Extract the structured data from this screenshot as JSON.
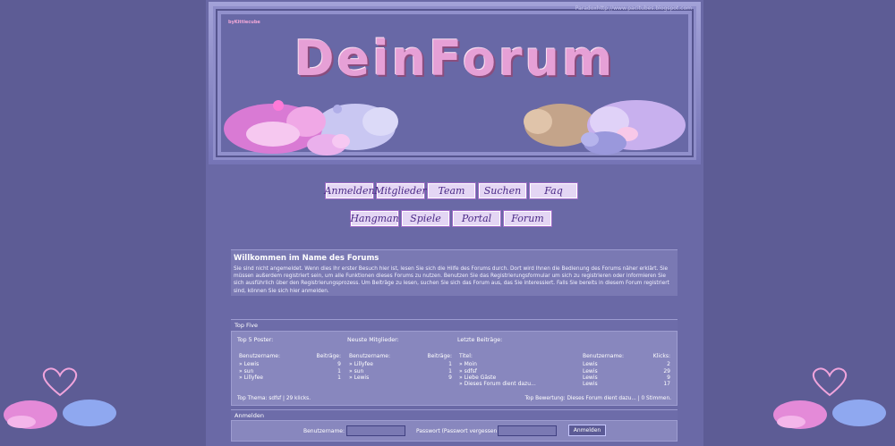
{
  "banner": {
    "tag": "byKittiecube",
    "credit": "Paradoxhttp://www.pacitubes.blogspot.com",
    "title": "DeinForum"
  },
  "nav": {
    "row1": [
      "Anmelden",
      "Mitglieder",
      "Team",
      "Suchen",
      "Faq"
    ],
    "row2": [
      "Hangman",
      "Spiele",
      "Portal",
      "Forum"
    ]
  },
  "welcome": {
    "title": "Willkommen im Name des Forums",
    "text": "Sie sind nicht angemeldet. Wenn dies Ihr erster Besuch hier ist, lesen Sie sich die Hilfe des Forums durch. Dort wird Ihnen die Bedienung des Forums näher erklärt. Sie müssen außerdem registriert sein, um alle Funktionen dieses Forums zu nutzen. Benutzen Sie das Registrierungsformular um sich zu registrieren oder informieren Sie sich ausführlich über den Registrierungsprozess. Um Beiträge zu lesen, suchen Sie sich das Forum aus, das Sie interessiert. Falls Sie bereits in diesem Forum registriert sind, können Sie sich hier anmelden."
  },
  "topfive": {
    "header": "Top Five",
    "posters": {
      "title": "Top 5 Poster:",
      "col_user": "Benutzername:",
      "col_count": "Beiträge:",
      "rows": [
        {
          "name": "» Lewis",
          "count": "9"
        },
        {
          "name": "» sun",
          "count": "1"
        },
        {
          "name": "» Lillyfee",
          "count": "1"
        }
      ]
    },
    "members": {
      "title": "Neuste Mitglieder:",
      "col_user": "Benutzername:",
      "col_count": "Beiträge:",
      "rows": [
        {
          "name": "» Lillyfee",
          "count": "1"
        },
        {
          "name": "» sun",
          "count": "1"
        },
        {
          "name": "» Lewis",
          "count": "9"
        }
      ]
    },
    "posts": {
      "title": "Letzte Beiträge:",
      "col_title": "Titel:",
      "col_user": "Benutzername:",
      "col_clicks": "Klicks:",
      "rows": [
        {
          "title": "» Moin",
          "user": "Lewis",
          "clicks": "2"
        },
        {
          "title": "» sdfsf",
          "user": "Lewis",
          "clicks": "29"
        },
        {
          "title": "» Liebe Gäste",
          "user": "Lewis",
          "clicks": "9"
        },
        {
          "title": "» Dieses Forum dient dazu...",
          "user": "Lewis",
          "clicks": "17"
        }
      ]
    },
    "top_thema": "Top Thema: sdfsf | 29 klicks.",
    "top_bewertung": "Top Bewertung: Dieses Forum dient dazu... | 0 Stimmen."
  },
  "login": {
    "header": "Anmelden",
    "user_label": "Benutzername:",
    "pass_label": "Passwort (Passwort vergessen):",
    "button": "Anmelden"
  },
  "colors": {
    "background": "#5d5c95",
    "page": "#6a69a6",
    "panel": "#8887be",
    "nav_button": "#e4d6f4",
    "title_pink": "#e6a0d6"
  }
}
